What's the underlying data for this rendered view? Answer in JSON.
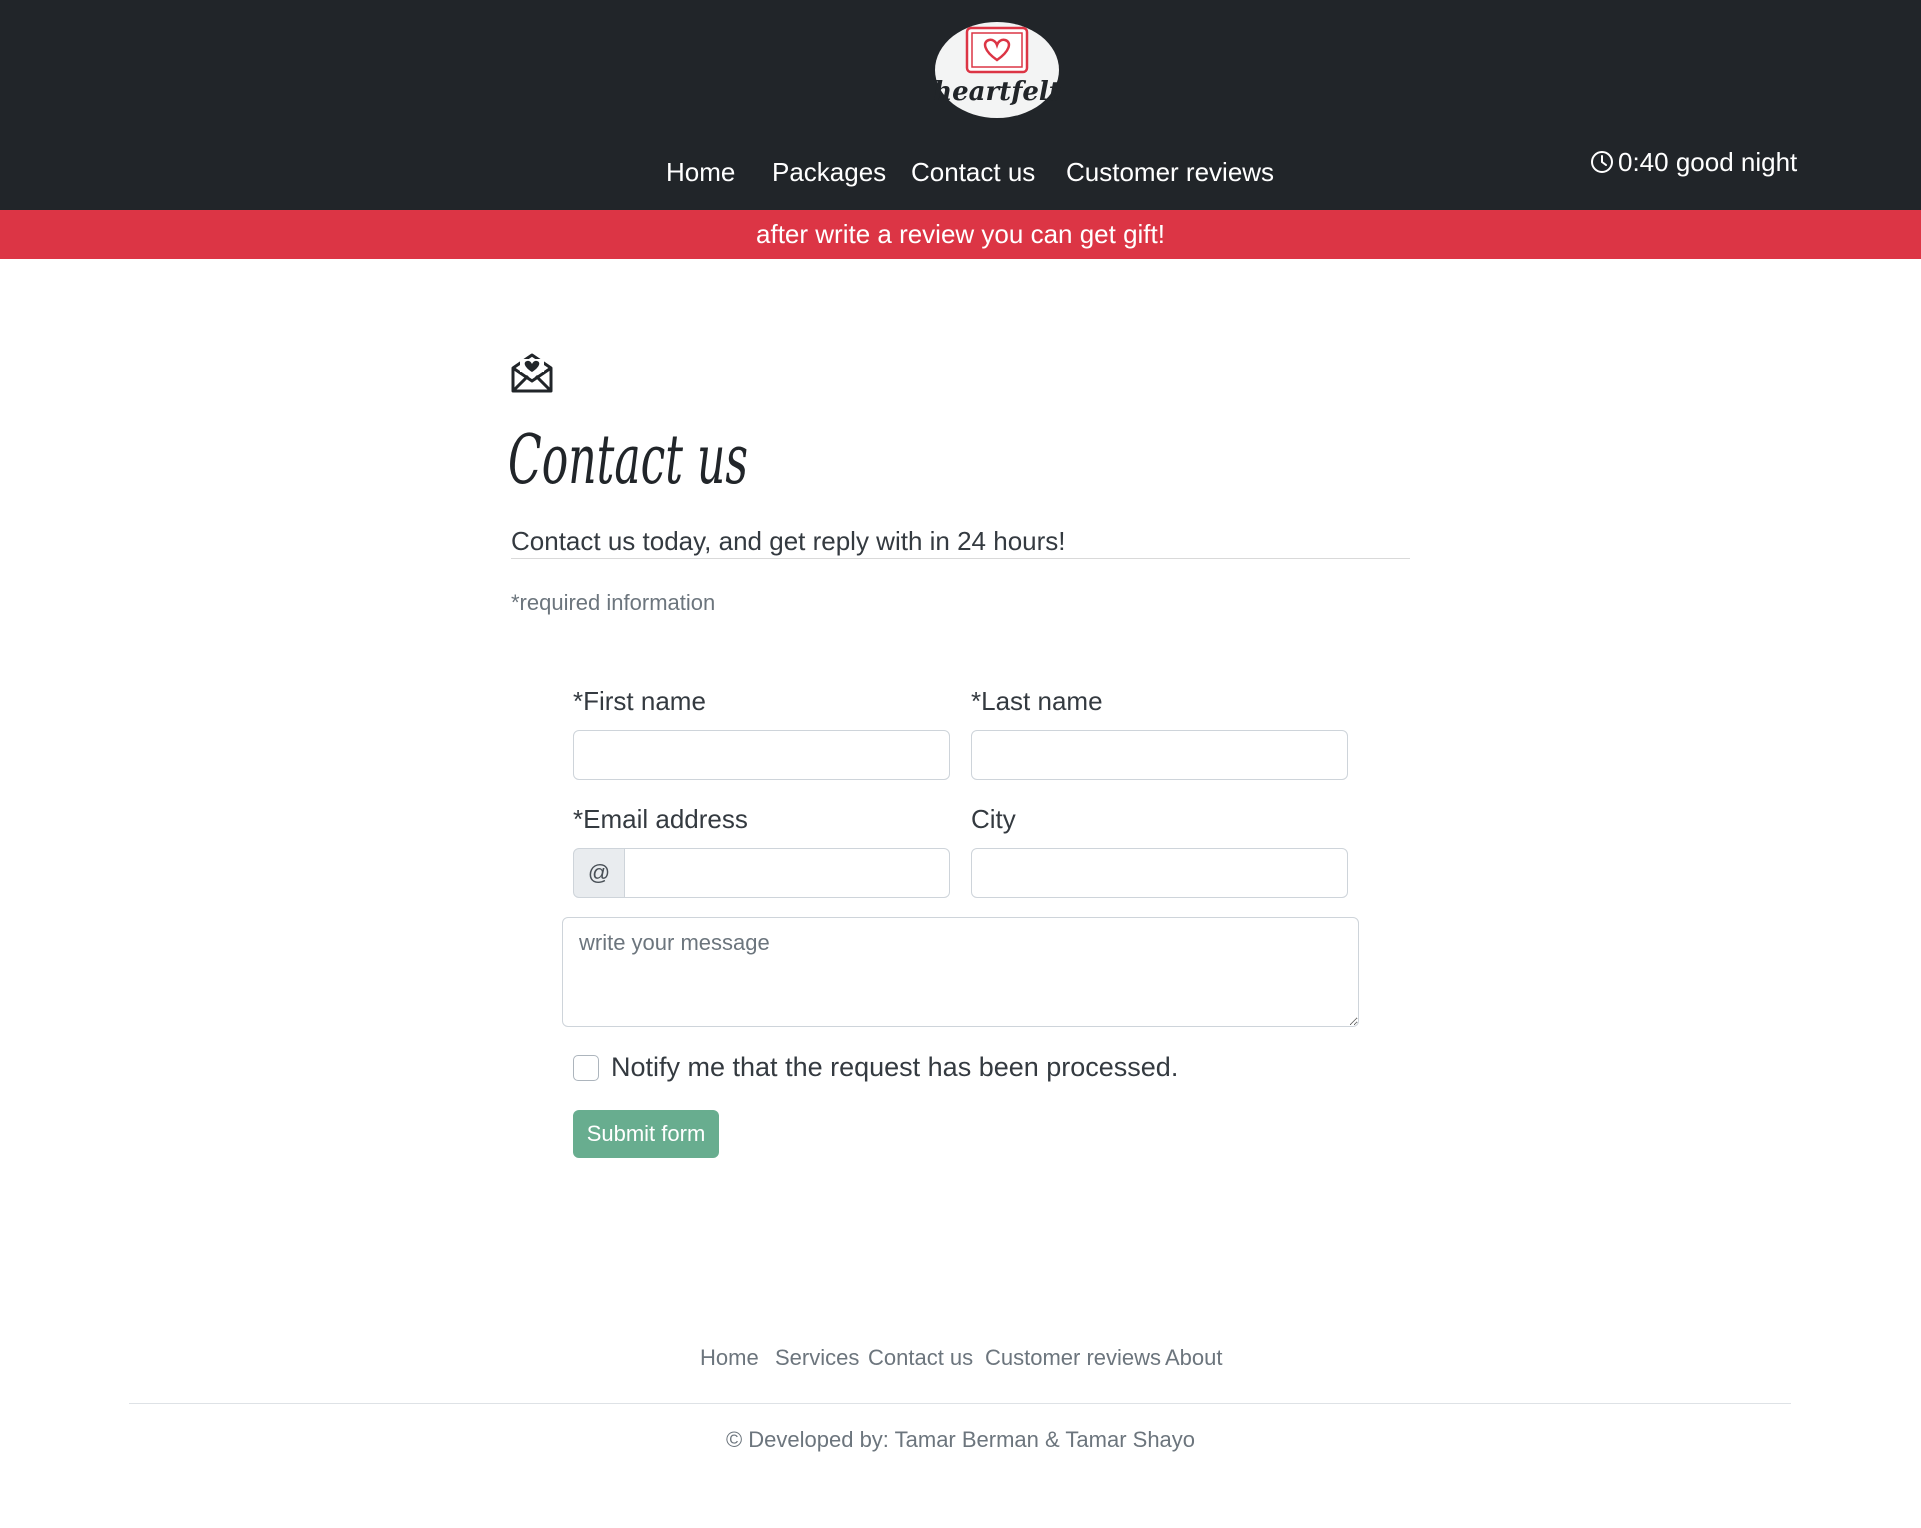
{
  "header": {
    "logo_text": "heartfelt",
    "nav": [
      "Home",
      "Packages",
      "Contact us",
      "Customer reviews"
    ],
    "clock_text": "0:40 good night"
  },
  "promo": {
    "text": "after write a review you can get gift!"
  },
  "contact": {
    "title": "Contact us",
    "subheading": "Contact us today, and get reply with in 24 hours!",
    "required_note": "*required information"
  },
  "form": {
    "first_name_label": "*First name",
    "first_name_value": "",
    "last_name_label": "*Last name",
    "last_name_value": "",
    "email_label": "*Email address",
    "email_addon": "@",
    "email_value": "",
    "city_label": "City",
    "city_value": "",
    "message_placeholder": "write your message",
    "notify_label": "Notify me that the request has been processed.",
    "notify_checked": false,
    "submit_label": "Submit form",
    "submit_color": "#68ad8f"
  },
  "footer": {
    "links": [
      "Home",
      "Services",
      "Contact us",
      "Customer reviews",
      "About"
    ],
    "copyright": "© Developed by: Tamar Berman & Tamar Shayo"
  },
  "colors": {
    "header_bg": "#212529",
    "promo_bg": "#dc3545",
    "muted_text": "#6c757d"
  }
}
